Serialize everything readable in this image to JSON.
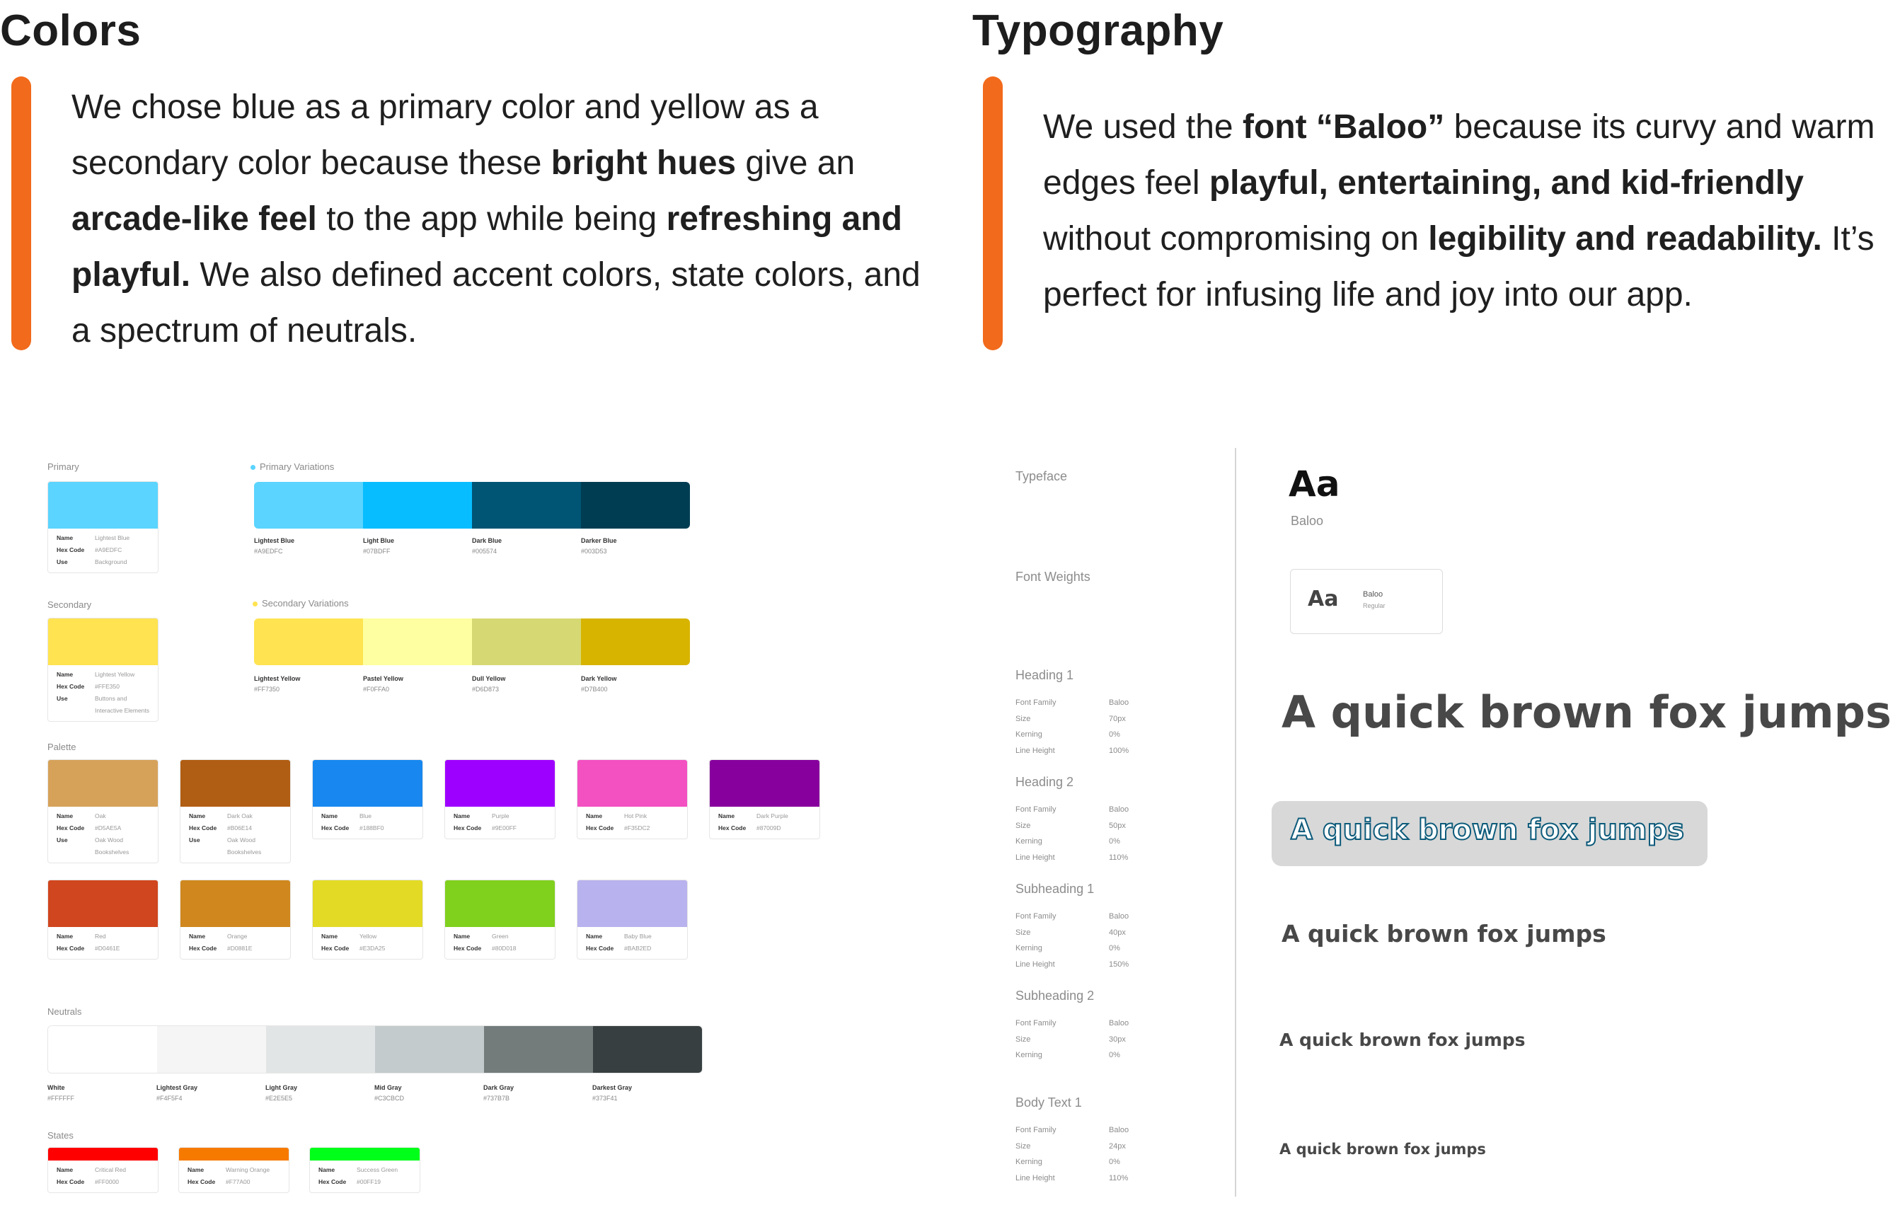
{
  "colors": {
    "title": "Colors",
    "paragraph_html": "We chose blue as a primary color and yellow as a secondary color because these <b>bright hues</b> give an <b>arcade-like feel</b> to the app while being <b>refreshing and playful.</b> We also defined accent colors, state colors, and a spectrum of neutrals."
  },
  "typography": {
    "title": "Typography",
    "paragraph_html": "We used the <b>font “Baloo”</b> because its curvy and warm edges feel <b>playful, entertaining, and kid-friendly</b> without compromising on <b>legibility and readability.</b> It’s perfect for infusing life and joy into our app."
  },
  "accent_color": "#F26A1B",
  "primary": {
    "label": "Primary",
    "card": {
      "color": "#5BD4FF",
      "rows": [
        {
          "k": "Name",
          "v": "Lightest Blue"
        },
        {
          "k": "Hex Code",
          "v": "#A9EDFC"
        },
        {
          "k": "Use",
          "v": "Background"
        }
      ]
    },
    "variations_label": "Primary Variations",
    "dot_color": "#5BD4FF",
    "swatches": [
      {
        "name": "Lightest Blue",
        "hex": "#A9EDFC",
        "color": "#5BD4FF"
      },
      {
        "name": "Light Blue",
        "hex": "#07BDFF",
        "color": "#07BDFF"
      },
      {
        "name": "Dark Blue",
        "hex": "#005574",
        "color": "#005574"
      },
      {
        "name": "Darker Blue",
        "hex": "#003D53",
        "color": "#003D53"
      }
    ]
  },
  "secondary": {
    "label": "Secondary",
    "card": {
      "color": "#FFE350",
      "rows": [
        {
          "k": "Name",
          "v": "Lightest Yellow"
        },
        {
          "k": "Hex Code",
          "v": "#FFE350"
        },
        {
          "k": "Use",
          "v": "Buttons and Interactive Elements"
        }
      ]
    },
    "variations_label": "Secondary Variations",
    "dot_color": "#FFE350",
    "swatches": [
      {
        "name": "Lightest Yellow",
        "hex": "#FF7350",
        "color": "#FFE350"
      },
      {
        "name": "Pastel Yellow",
        "hex": "#F0FFA0",
        "color": "#FDFFA0"
      },
      {
        "name": "Dull Yellow",
        "hex": "#D6D873",
        "color": "#D6D873"
      },
      {
        "name": "Dark Yellow",
        "hex": "#D7B400",
        "color": "#D7B400"
      }
    ]
  },
  "palette": {
    "label": "Palette",
    "row1": [
      {
        "color": "#D6A25A",
        "rows": [
          {
            "k": "Name",
            "v": "Oak"
          },
          {
            "k": "Hex Code",
            "v": "#D5AE5A"
          },
          {
            "k": "Use",
            "v": "Oak Wood Bookshelves"
          }
        ]
      },
      {
        "color": "#B05E14",
        "rows": [
          {
            "k": "Name",
            "v": "Dark Oak"
          },
          {
            "k": "Hex Code",
            "v": "#B06E14"
          },
          {
            "k": "Use",
            "v": "Oak Wood Bookshelves"
          }
        ]
      },
      {
        "color": "#1888F0",
        "rows": [
          {
            "k": "Name",
            "v": "Blue"
          },
          {
            "k": "Hex Code",
            "v": "#188BF0"
          }
        ]
      },
      {
        "color": "#9E00FF",
        "rows": [
          {
            "k": "Name",
            "v": "Purple"
          },
          {
            "k": "Hex Code",
            "v": "#9E00FF"
          }
        ]
      },
      {
        "color": "#F350C2",
        "rows": [
          {
            "k": "Name",
            "v": "Hot Pink"
          },
          {
            "k": "Hex Code",
            "v": "#F35DC2"
          }
        ]
      },
      {
        "color": "#87009D",
        "rows": [
          {
            "k": "Name",
            "v": "Dark Purple"
          },
          {
            "k": "Hex Code",
            "v": "#87009D"
          }
        ]
      }
    ],
    "row2": [
      {
        "color": "#D0461E",
        "rows": [
          {
            "k": "Name",
            "v": "Red"
          },
          {
            "k": "Hex Code",
            "v": "#D0461E"
          }
        ]
      },
      {
        "color": "#D0881E",
        "rows": [
          {
            "k": "Name",
            "v": "Orange"
          },
          {
            "k": "Hex Code",
            "v": "#D0881E"
          }
        ]
      },
      {
        "color": "#E2DA25",
        "rows": [
          {
            "k": "Name",
            "v": "Yellow"
          },
          {
            "k": "Hex Code",
            "v": "#E3DA25"
          }
        ]
      },
      {
        "color": "#80D01E",
        "rows": [
          {
            "k": "Name",
            "v": "Green"
          },
          {
            "k": "Hex Code",
            "v": "#80D018"
          }
        ]
      },
      {
        "color": "#B8B2EE",
        "rows": [
          {
            "k": "Name",
            "v": "Baby Blue"
          },
          {
            "k": "Hex Code",
            "v": "#BAB2ED"
          }
        ]
      }
    ]
  },
  "neutrals": {
    "label": "Neutrals",
    "swatches": [
      {
        "name": "White",
        "hex": "#FFFFFF",
        "color": "#FFFFFF"
      },
      {
        "name": "Lightest Gray",
        "hex": "#F4F5F4",
        "color": "#F4F5F4"
      },
      {
        "name": "Light Gray",
        "hex": "#E2E5E5",
        "color": "#E2E5E5"
      },
      {
        "name": "Mid Gray",
        "hex": "#C3CBCD",
        "color": "#C3CBCD"
      },
      {
        "name": "Dark Gray",
        "hex": "#737B7B",
        "color": "#737B7B"
      },
      {
        "name": "Darkest Gray",
        "hex": "#373F41",
        "color": "#373F41"
      }
    ]
  },
  "states": {
    "label": "States",
    "cards": [
      {
        "color": "#FF0000",
        "rows": [
          {
            "k": "Name",
            "v": "Critical Red"
          },
          {
            "k": "Hex Code",
            "v": "#FF0000"
          }
        ]
      },
      {
        "color": "#F77A00",
        "rows": [
          {
            "k": "Name",
            "v": "Warning Orange"
          },
          {
            "k": "Hex Code",
            "v": "#F77A00"
          }
        ]
      },
      {
        "color": "#00FF19",
        "rows": [
          {
            "k": "Name",
            "v": "Success Green"
          },
          {
            "k": "Hex Code",
            "v": "#00FF19"
          }
        ]
      }
    ]
  },
  "type_spec": {
    "typeface_label": "Typeface",
    "typeface_aa": "Aa",
    "typeface_name": "Baloo",
    "weights_label": "Font Weights",
    "weight_card": {
      "aa": "Aa",
      "name": "Baloo",
      "style": "Regular"
    },
    "sample_text": "A quick brown fox jumps",
    "blocks": [
      {
        "title": "Heading 1",
        "rows": [
          {
            "k": "Font Family",
            "v": "Baloo"
          },
          {
            "k": "Size",
            "v": "70px"
          },
          {
            "k": "Kerning",
            "v": "0%"
          },
          {
            "k": "Line Height",
            "v": "100%"
          }
        ]
      },
      {
        "title": "Heading 2",
        "rows": [
          {
            "k": "Font Family",
            "v": "Baloo"
          },
          {
            "k": "Size",
            "v": "50px"
          },
          {
            "k": "Kerning",
            "v": "0%"
          },
          {
            "k": "Line Height",
            "v": "110%"
          }
        ]
      },
      {
        "title": "Subheading 1",
        "rows": [
          {
            "k": "Font Family",
            "v": "Baloo"
          },
          {
            "k": "Size",
            "v": "40px"
          },
          {
            "k": "Kerning",
            "v": "0%"
          },
          {
            "k": "Line Height",
            "v": "150%"
          }
        ]
      },
      {
        "title": "Subheading 2",
        "rows": [
          {
            "k": "Font Family",
            "v": "Baloo"
          },
          {
            "k": "Size",
            "v": "30px"
          },
          {
            "k": "Kerning",
            "v": "0%"
          }
        ]
      },
      {
        "title": "Body Text 1",
        "rows": [
          {
            "k": "Font Family",
            "v": "Baloo"
          },
          {
            "k": "Size",
            "v": "24px"
          },
          {
            "k": "Kerning",
            "v": "0%"
          },
          {
            "k": "Line Height",
            "v": "110%"
          }
        ]
      }
    ]
  }
}
